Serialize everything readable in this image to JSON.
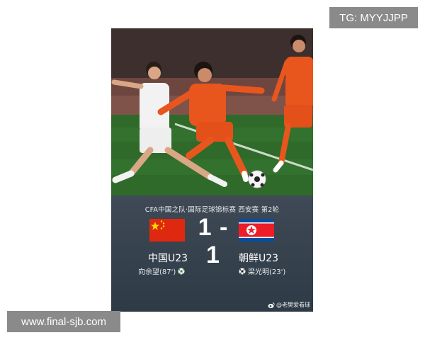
{
  "overlay": {
    "tg_badge": "TG: MYYJJPP",
    "site_watermark": "www.final-sjb.com"
  },
  "match_card": {
    "competition": "CFA中国之队·国际足球锦标赛 西安赛 第2轮",
    "score": "1 - 1",
    "home": {
      "team": "中国U23",
      "scorer": "向余望(87')",
      "flag_icon": "china-flag-icon",
      "flag_color": "#de2910"
    },
    "away": {
      "team": "朝鲜U23",
      "scorer": "梁光明(23')",
      "flag_icon": "north-korea-flag-icon",
      "flag_color": "#024fa2"
    },
    "credit": "@老樊爱看球",
    "panel_color": "#3a4652"
  },
  "photo": {
    "home_kit_color": "#e8561e",
    "away_kit_color": "#f2f2f2",
    "pitch_color": "#2f6a2a"
  }
}
